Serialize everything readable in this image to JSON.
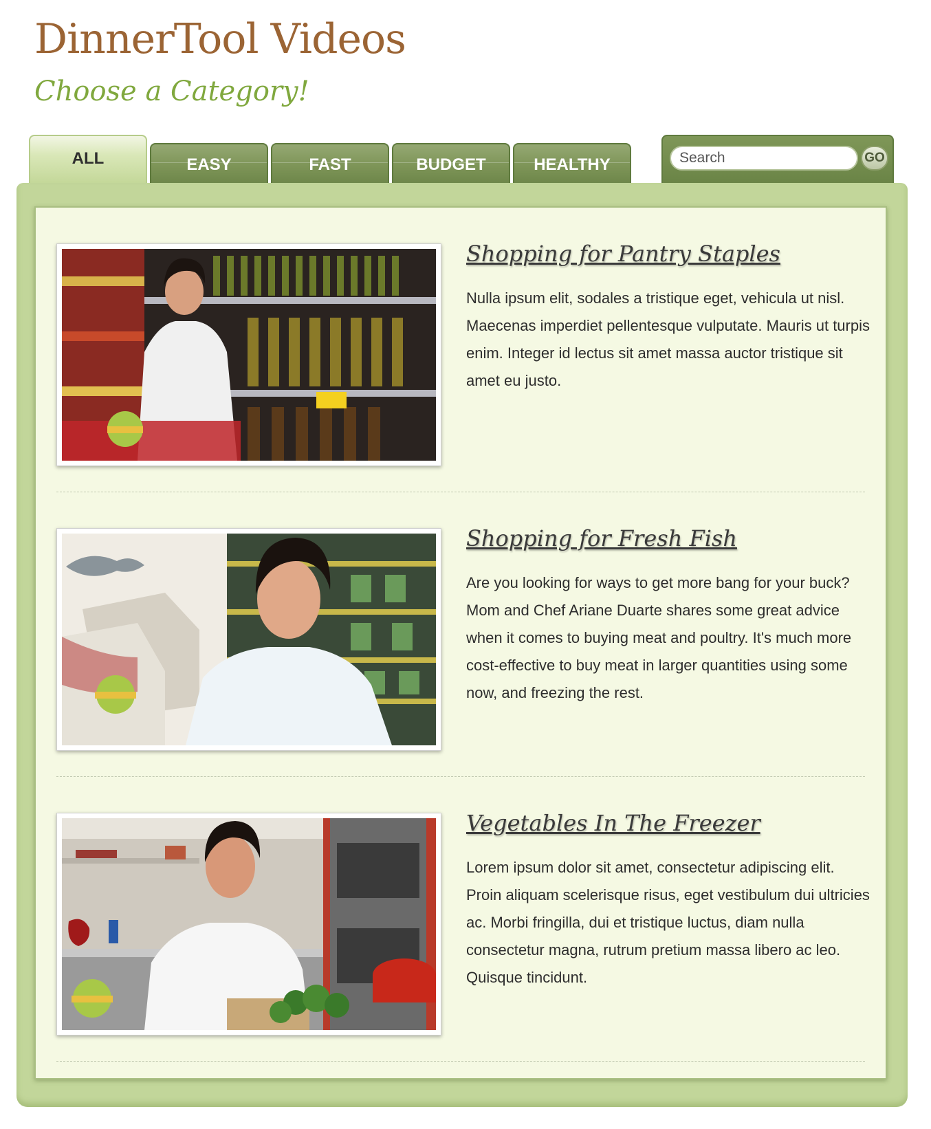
{
  "header": {
    "title": "DinnerTool Videos",
    "subtitle": "Choose a Category!"
  },
  "tabs": [
    {
      "label": "ALL",
      "active": true
    },
    {
      "label": "EASY",
      "active": false
    },
    {
      "label": "FAST",
      "active": false
    },
    {
      "label": "BUDGET",
      "active": false
    },
    {
      "label": "HEALTHY",
      "active": false
    }
  ],
  "search": {
    "placeholder": "Search",
    "go_label": "GO"
  },
  "videos": [
    {
      "title": "Shopping for Pantry Staples",
      "description": "Nulla ipsum elit, sodales a tristique eget, vehicula ut nisl. Maecenas imperdiet pellentesque vulputate. Mauris ut turpis enim. Integer id lectus sit amet massa auctor tristique sit amet eu justo."
    },
    {
      "title": "Shopping for Fresh Fish",
      "description": "Are you looking for ways to get more bang for your buck? Mom and Chef Ariane Duarte shares some great advice when it comes to buying meat and poultry. It's much more cost-effective to buy meat in larger quantities using some now, and freezing the rest."
    },
    {
      "title": "Vegetables In The Freezer",
      "description": "Lorem ipsum dolor sit amet, consectetur adipiscing elit. Proin aliquam scelerisque risus, eget vestibulum dui ultricies ac. Morbi fringilla, dui et tristique luctus, diam nulla consectetur magna, rutrum pretium massa libero ac leo. Quisque tincidunt."
    }
  ],
  "colors": {
    "brand_title": "#9b6434",
    "subtitle_green": "#80a83e",
    "tab_green": "#7e9558",
    "panel_green": "#c2d69a",
    "content_bg": "#f5f9e3"
  }
}
